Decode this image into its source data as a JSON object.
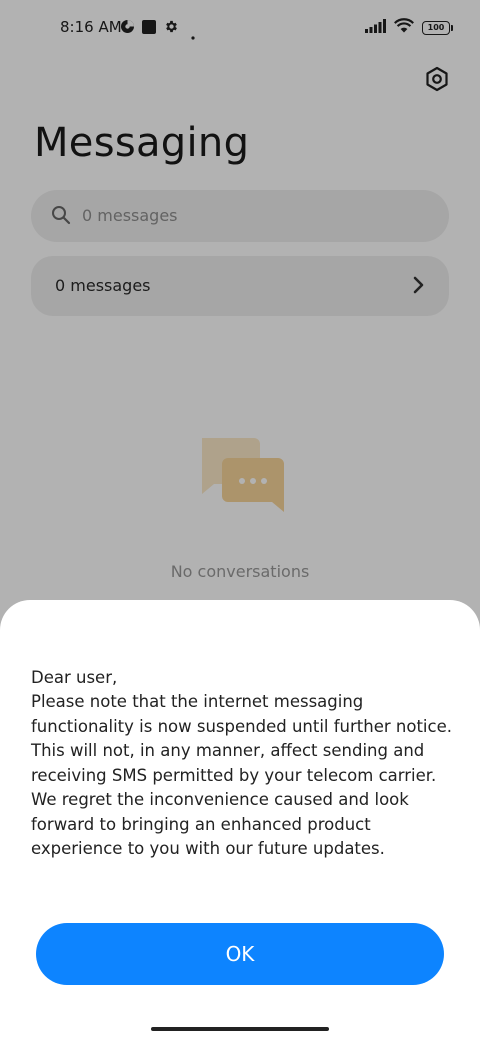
{
  "status_bar": {
    "time": "8:16 AM",
    "battery": "100"
  },
  "header": {
    "title": "Messaging"
  },
  "search": {
    "placeholder": "0 messages"
  },
  "messages_row": {
    "label": "0 messages"
  },
  "empty_state": {
    "label": "No conversations"
  },
  "dialog": {
    "greeting": "Dear user,",
    "body": "Please note that the internet messaging functionality is now suspended until further notice. This will not, in any manner, affect sending and receiving SMS permitted by your telecom carrier. We regret the inconvenience caused and look forward to bringing an enhanced product experience to you with our future updates.",
    "ok_label": "OK"
  },
  "colors": {
    "accent": "#0d84ff",
    "illustration_back": "#fbe9c8",
    "illustration_front": "#f7d59a"
  },
  "icons": {
    "settings": "settings-hexagon-icon",
    "search": "search-icon",
    "chevron": "chevron-right-icon",
    "empty": "chat-bubbles-icon"
  }
}
